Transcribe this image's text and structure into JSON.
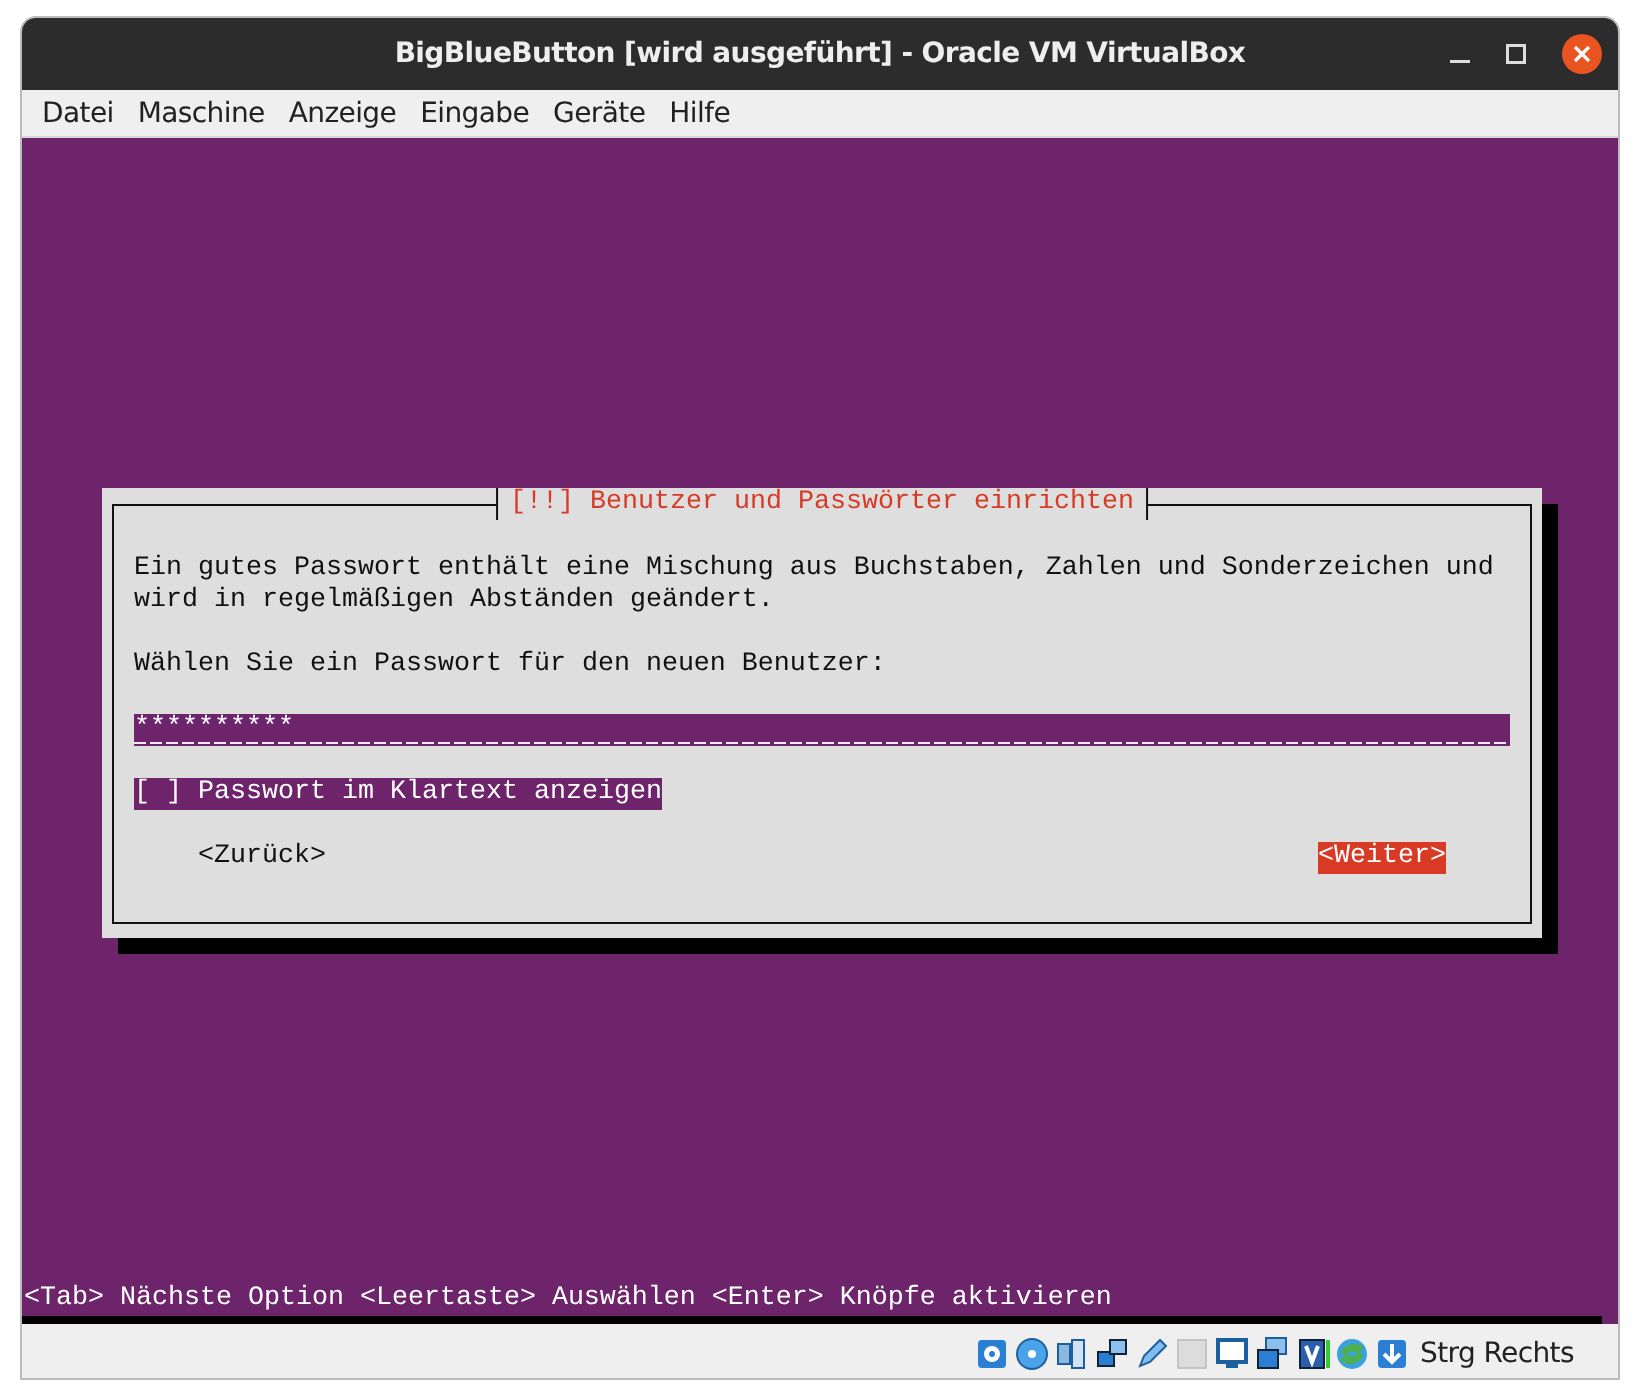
{
  "window": {
    "title": "BigBlueButton [wird ausgeführt] - Oracle VM VirtualBox"
  },
  "menu": [
    "Datei",
    "Maschine",
    "Anzeige",
    "Eingabe",
    "Geräte",
    "Hilfe"
  ],
  "dialog": {
    "title": "[!!] Benutzer und Passwörter einrichten",
    "description": "Ein gutes Passwort enthält eine Mischung aus Buchstaben, Zahlen und Sonderzeichen und wird in regelmäßigen Abständen geändert.",
    "prompt": "Wählen Sie ein Passwort für den neuen Benutzer:",
    "password": {
      "value": "**********"
    },
    "checkbox": {
      "mark": "[ ]",
      "label": "Passwort im Klartext anzeigen",
      "checked": false,
      "focused": true
    },
    "buttons": [
      {
        "label": "<Zurück>",
        "selected": false
      },
      {
        "label": "<Weiter>",
        "selected": true
      }
    ]
  },
  "hint": "<Tab> Nächste Option <Leertaste> Auswählen <Enter> Knöpfe aktivieren",
  "status_bar": {
    "host_key": "Strg Rechts"
  }
}
